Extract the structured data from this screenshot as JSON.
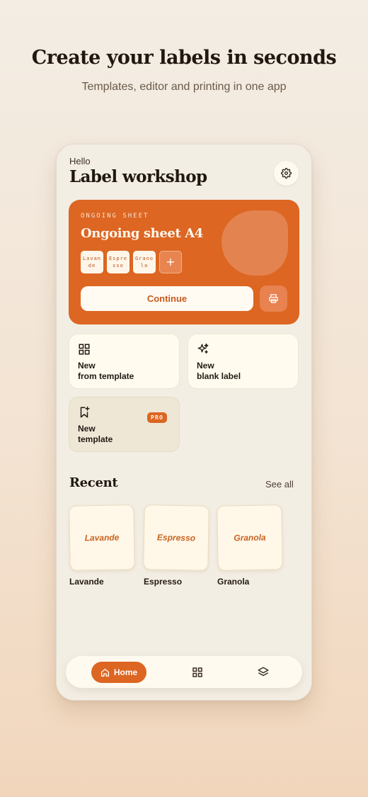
{
  "hero": {
    "title": "Create your labels in seconds",
    "subtitle": "Templates, editor and printing in one app"
  },
  "header": {
    "greeting": "Hello",
    "title": "Label workshop",
    "settings_icon": "gear-icon"
  },
  "ongoing_sheet": {
    "eyebrow": "ONGOING SHEET",
    "title": "Ongoing sheet A4",
    "chips": [
      "Lavande",
      "Espresso",
      "Granola"
    ],
    "add_chip": "+",
    "continue_label": "Continue",
    "print_icon": "printer-icon"
  },
  "actions": {
    "from_template": {
      "label": "New\nfrom template",
      "icon": "grid-icon"
    },
    "blank_label": {
      "label": "New\nblank label",
      "icon": "sparkles-icon"
    },
    "new_template": {
      "label": "New\ntemplate",
      "icon": "bookmark-plus-icon",
      "badge": "PRO"
    }
  },
  "recent": {
    "title": "Recent",
    "see_all": "See all",
    "items": [
      {
        "preview": "Lavande",
        "name": "Lavande"
      },
      {
        "preview": "Espresso",
        "name": "Espresso"
      },
      {
        "preview": "Granola",
        "name": "Granola"
      }
    ]
  },
  "nav": {
    "home_label": "Home",
    "home_icon": "home-icon",
    "templates_icon": "grid-icon",
    "layers_icon": "layers-icon"
  },
  "colors": {
    "accent": "#dc6622",
    "card_bg": "#fffbef",
    "surface": "#f3eee4"
  }
}
